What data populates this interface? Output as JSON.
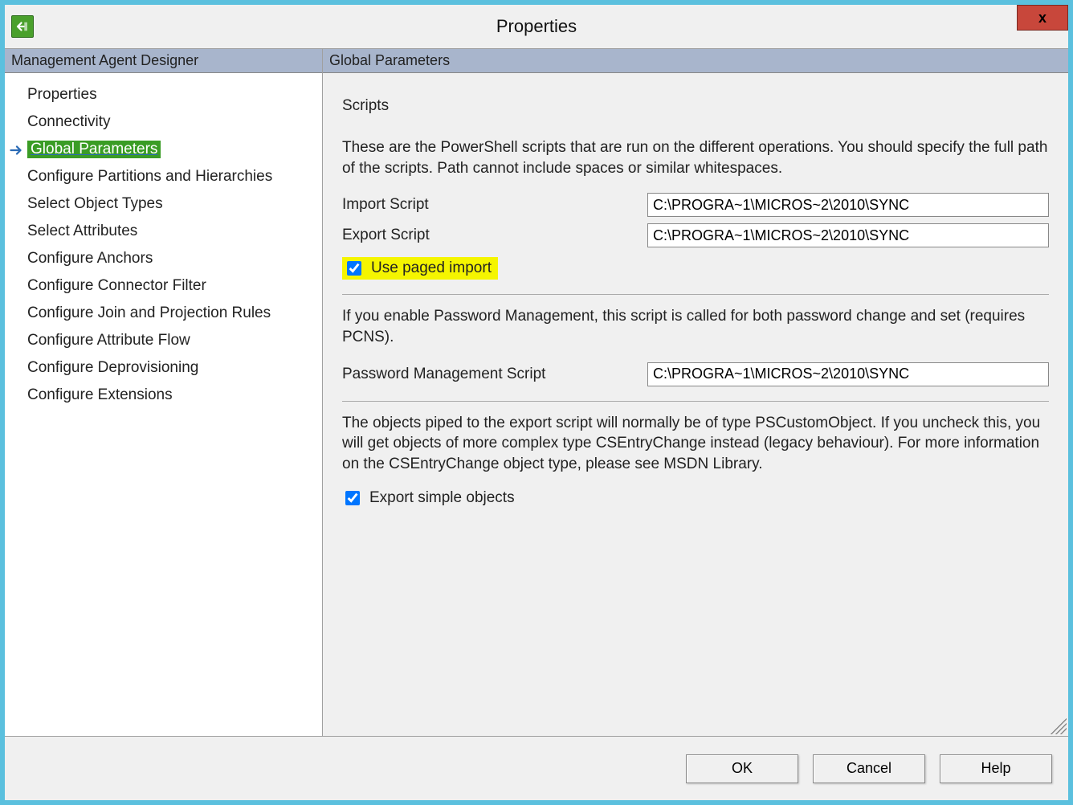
{
  "window": {
    "title": "Properties",
    "close_glyph": "x"
  },
  "sidebar": {
    "header": "Management Agent Designer",
    "items": [
      {
        "label": "Properties",
        "selected": false
      },
      {
        "label": "Connectivity",
        "selected": false
      },
      {
        "label": "Global Parameters",
        "selected": true
      },
      {
        "label": "Configure Partitions and Hierarchies",
        "selected": false
      },
      {
        "label": "Select Object Types",
        "selected": false
      },
      {
        "label": "Select Attributes",
        "selected": false
      },
      {
        "label": "Configure Anchors",
        "selected": false
      },
      {
        "label": "Configure Connector Filter",
        "selected": false
      },
      {
        "label": "Configure Join and Projection Rules",
        "selected": false
      },
      {
        "label": "Configure Attribute Flow",
        "selected": false
      },
      {
        "label": "Configure Deprovisioning",
        "selected": false
      },
      {
        "label": "Configure Extensions",
        "selected": false
      }
    ]
  },
  "main": {
    "header": "Global Parameters",
    "scripts_heading": "Scripts",
    "scripts_desc": "These are the PowerShell scripts that are run on the different operations. You should specify the full path of the scripts. Path cannot include spaces or similar whitespaces.",
    "import_label": "Import Script",
    "import_value": "C:\\PROGRA~1\\MICROS~2\\2010\\SYNC",
    "export_label": "Export Script",
    "export_value": "C:\\PROGRA~1\\MICROS~2\\2010\\SYNC",
    "paged_import_label": "Use paged import",
    "paged_import_checked": true,
    "pwd_desc": "If you enable Password Management, this script is called for both password change and set (requires PCNS).",
    "pwd_label": "Password Management Script",
    "pwd_value": "C:\\PROGRA~1\\MICROS~2\\2010\\SYNC",
    "export_simple_desc": "The objects piped to the export script will normally be of type PSCustomObject. If you uncheck this, you will get objects of more complex type CSEntryChange instead (legacy behaviour). For more information on the CSEntryChange object type, please see MSDN Library.",
    "export_simple_label": "Export simple objects",
    "export_simple_checked": true
  },
  "footer": {
    "ok": "OK",
    "cancel": "Cancel",
    "help": "Help"
  }
}
